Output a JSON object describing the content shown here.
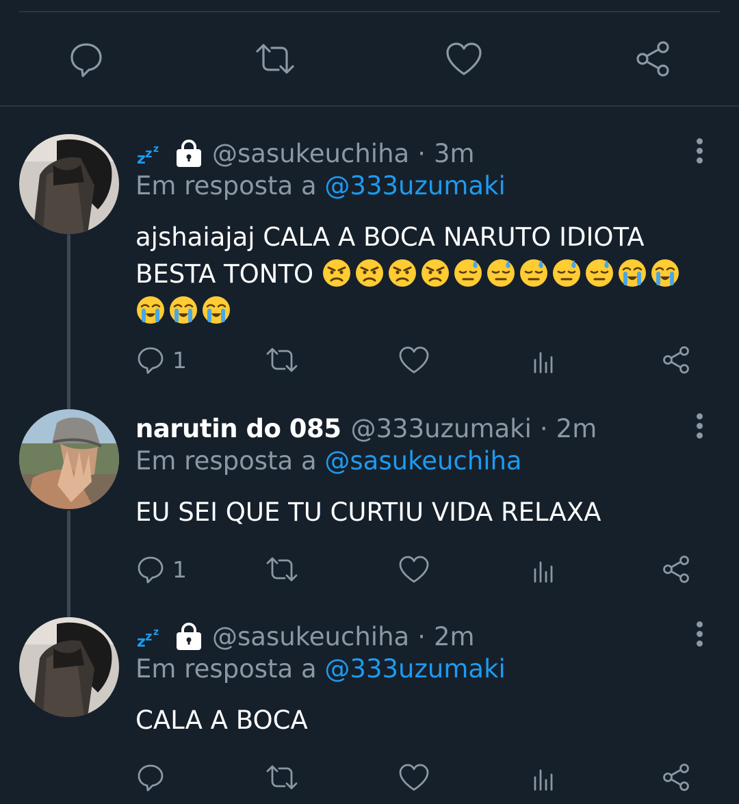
{
  "main_actions": {
    "icons": [
      "reply-icon",
      "retweet-icon",
      "like-icon",
      "share-icon"
    ]
  },
  "tweets": [
    {
      "display_name": "",
      "name_emojis": [
        "zzz-emoji",
        "lock-emoji"
      ],
      "handle": "@sasukeuchiha",
      "separator": "·",
      "time": "3m",
      "reply_prefix": "Em resposta a",
      "reply_to": "@333uzumaki",
      "text": "ajshaiajaj CALA A BOCA NARUTO IDIOTA BESTA TONTO",
      "emojis": [
        "angry",
        "angry",
        "angry",
        "angry",
        "sweat",
        "sweat",
        "sweat",
        "sweat",
        "sweat",
        "sob",
        "sob",
        "sob",
        "sob",
        "sob"
      ],
      "reply_count": "1"
    },
    {
      "display_name": "narutin do 085",
      "handle": "@333uzumaki",
      "separator": "·",
      "time": "2m",
      "reply_prefix": "Em resposta a",
      "reply_to": "@sasukeuchiha",
      "text": "EU SEI QUE TU CURTIU VIDA RELAXA",
      "reply_count": "1"
    },
    {
      "display_name": "",
      "name_emojis": [
        "zzz-emoji",
        "lock-emoji"
      ],
      "handle": "@sasukeuchiha",
      "separator": "·",
      "time": "2m",
      "reply_prefix": "Em resposta a",
      "reply_to": "@333uzumaki",
      "text": "CALA A BOCA",
      "reply_count": ""
    }
  ],
  "colors": {
    "background": "#16202b",
    "secondary_text": "#8b98a5",
    "link": "#1d9bf0",
    "divider": "#2b3642"
  }
}
